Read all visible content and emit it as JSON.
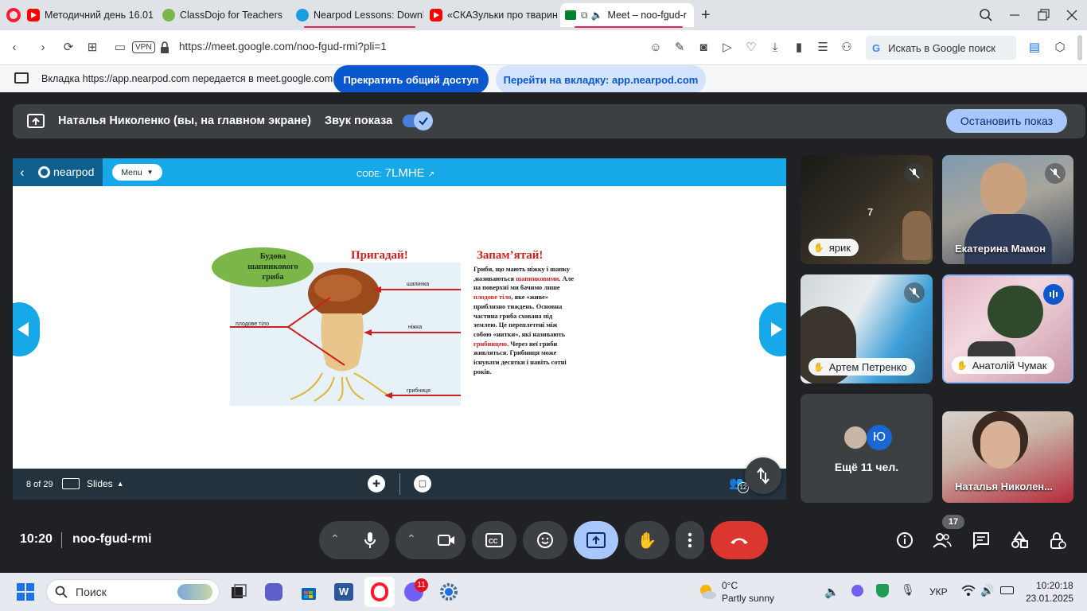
{
  "browser": {
    "tabs": [
      {
        "label": "Методичний день 16.01",
        "favicon": "youtube-icon",
        "color": "#ff0000"
      },
      {
        "label": "ClassDojo for Teachers",
        "favicon": "classdojo-icon",
        "color": "#7ab648"
      },
      {
        "label": "Nearpod Lessons: Downlo",
        "favicon": "nearpod-icon",
        "color": "#1a9ce3"
      },
      {
        "label": "«СКАЗульки про тварин»",
        "favicon": "youtube-icon",
        "color": "#ff0000"
      },
      {
        "label": "Meet – noo-fgud-r",
        "favicon": "meet-icon",
        "color": "#00832d"
      }
    ],
    "url": "https://meet.google.com/noo-fgud-rmi?pli=1",
    "vpn_label": "VPN",
    "search_placeholder": "Искать в Google поиск"
  },
  "share_banner": {
    "text": "Вкладка https://app.nearpod.com передается в meet.google.com",
    "stop_sharing": "Прекратить общий доступ",
    "switch_tab": "Перейти на вкладку: app.nearpod.com"
  },
  "presenting_bar": {
    "presenter": "Наталья Николенко (вы, на главном экране)",
    "sound_label": "Звук показа",
    "stop_button": "Остановить показ",
    "sound_on": true
  },
  "nearpod": {
    "logo": "nearpod",
    "menu_label": "Menu",
    "code_label": "CODE:",
    "code": "7LMHE",
    "page": "8 of 29",
    "slides_label": "Slides",
    "participants_count": "12",
    "slide": {
      "title_left": "Пригадай!",
      "title_right": "Запам’ятай!",
      "bubble": "Будова шапинкового гриба",
      "labels": {
        "cap": "шапинка",
        "stem": "ніжка",
        "fruit_body": "плодове тіло",
        "mycelium": "грибниця"
      },
      "text_parts": [
        {
          "t": "Гриби, що мають ніжку і шапку ,називаються ",
          "red": false
        },
        {
          "t": "шапинковими",
          "red": true
        },
        {
          "t": ". Але на поверхні ми бачимо лише ",
          "red": false
        },
        {
          "t": "плодове тіло",
          "red": true
        },
        {
          "t": ", яке «живе» приблизно тиждень. Основна частина гриба схована під землею. Це переплетені між собою «нитки», які називають ",
          "red": false
        },
        {
          "t": "грибницею",
          "red": true
        },
        {
          "t": ". Через неї гриби живляться. Грибниця може існувати десятки і навіть сотні років.",
          "red": false
        }
      ]
    }
  },
  "participants": [
    {
      "name": "ярик",
      "muted": true
    },
    {
      "name": "Екатерина Мамон",
      "muted": true
    },
    {
      "name": "Артем Петренко",
      "muted": true
    },
    {
      "name": "Анатолій Чумак",
      "muted": false,
      "speaking": true
    },
    {
      "name": "Наталья Николен...",
      "muted": false
    }
  ],
  "more_tile": {
    "label": "Ещё 11 чел.",
    "avatar_letter": "Ю"
  },
  "meeting": {
    "time": "10:20",
    "code": "noo-fgud-rmi",
    "people_badge": "17"
  },
  "controls": {
    "items": [
      "mic-icon",
      "camera-icon",
      "captions-icon",
      "emoji-icon",
      "present-icon",
      "raise-hand-icon",
      "more-icon",
      "hangup-icon"
    ],
    "accent": "#a8c7fa",
    "hangup_color": "#dc362e"
  },
  "taskbar": {
    "search_label": "Поиск",
    "weather_temp": "0°C",
    "weather_text": "Partly sunny",
    "lang": "УКР",
    "time": "10:20:18",
    "date": "23.01.2025",
    "viber_badge": "11"
  }
}
